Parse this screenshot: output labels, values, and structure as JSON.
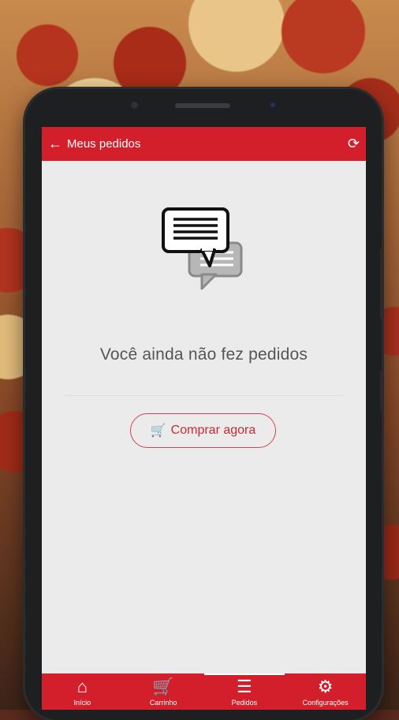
{
  "header": {
    "title": "Meus pedidos",
    "back_icon": "arrow-left-icon",
    "refresh_icon": "refresh-icon"
  },
  "empty_state": {
    "icon": "chat-bubbles-icon",
    "message": "Você ainda não fez pedidos",
    "button_label": "Comprar agora",
    "button_icon": "shopping-cart-icon"
  },
  "bottom_nav": {
    "items": [
      {
        "label": "Início",
        "icon": "home-icon"
      },
      {
        "label": "Carrinho",
        "icon": "shopping-cart-icon"
      },
      {
        "label": "Pedidos",
        "icon": "list-icon"
      },
      {
        "label": "Configurações",
        "icon": "gear-icon"
      }
    ]
  },
  "colors": {
    "primary": "#d21f2b",
    "background": "#ebebeb",
    "text": "#555555"
  }
}
